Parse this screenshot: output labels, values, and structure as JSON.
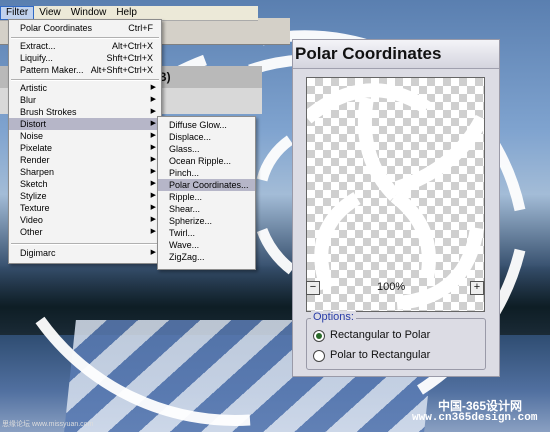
{
  "menubar": {
    "items": [
      "Filter",
      "View",
      "Window",
      "Help"
    ]
  },
  "document": {
    "title_fragment": "B)"
  },
  "filter_menu": {
    "top_items": [
      {
        "label": "Polar Coordinates",
        "shortcut": "Ctrl+F"
      },
      {
        "label": "Extract...",
        "shortcut": "Alt+Ctrl+X"
      },
      {
        "label": "Liquify...",
        "shortcut": "Shft+Ctrl+X"
      },
      {
        "label": "Pattern Maker...",
        "shortcut": "Alt+Shft+Ctrl+X"
      }
    ],
    "categories": [
      "Artistic",
      "Blur",
      "Brush Strokes",
      "Distort",
      "Noise",
      "Pixelate",
      "Render",
      "Sharpen",
      "Sketch",
      "Stylize",
      "Texture",
      "Video",
      "Other"
    ],
    "bottom_items": [
      "Digimarc"
    ]
  },
  "distort_submenu": {
    "items": [
      "Diffuse Glow...",
      "Displace...",
      "Glass...",
      "Ocean Ripple...",
      "Pinch...",
      "Polar Coordinates...",
      "Ripple...",
      "Shear...",
      "Spherize...",
      "Twirl...",
      "Wave...",
      "ZigZag..."
    ]
  },
  "dialog": {
    "title": "Polar Coordinates",
    "zoom_out": "−",
    "zoom_in": "+",
    "zoom": "100%",
    "options_label": "Options:",
    "options": [
      {
        "label": "Rectangular to Polar",
        "selected": true
      },
      {
        "label": "Polar to Rectangular",
        "selected": false
      }
    ]
  },
  "watermark": {
    "line1": "中国-365设计网",
    "line2": "www.cn365design.com",
    "corner": "思缘论坛  www.missyuan.com"
  }
}
